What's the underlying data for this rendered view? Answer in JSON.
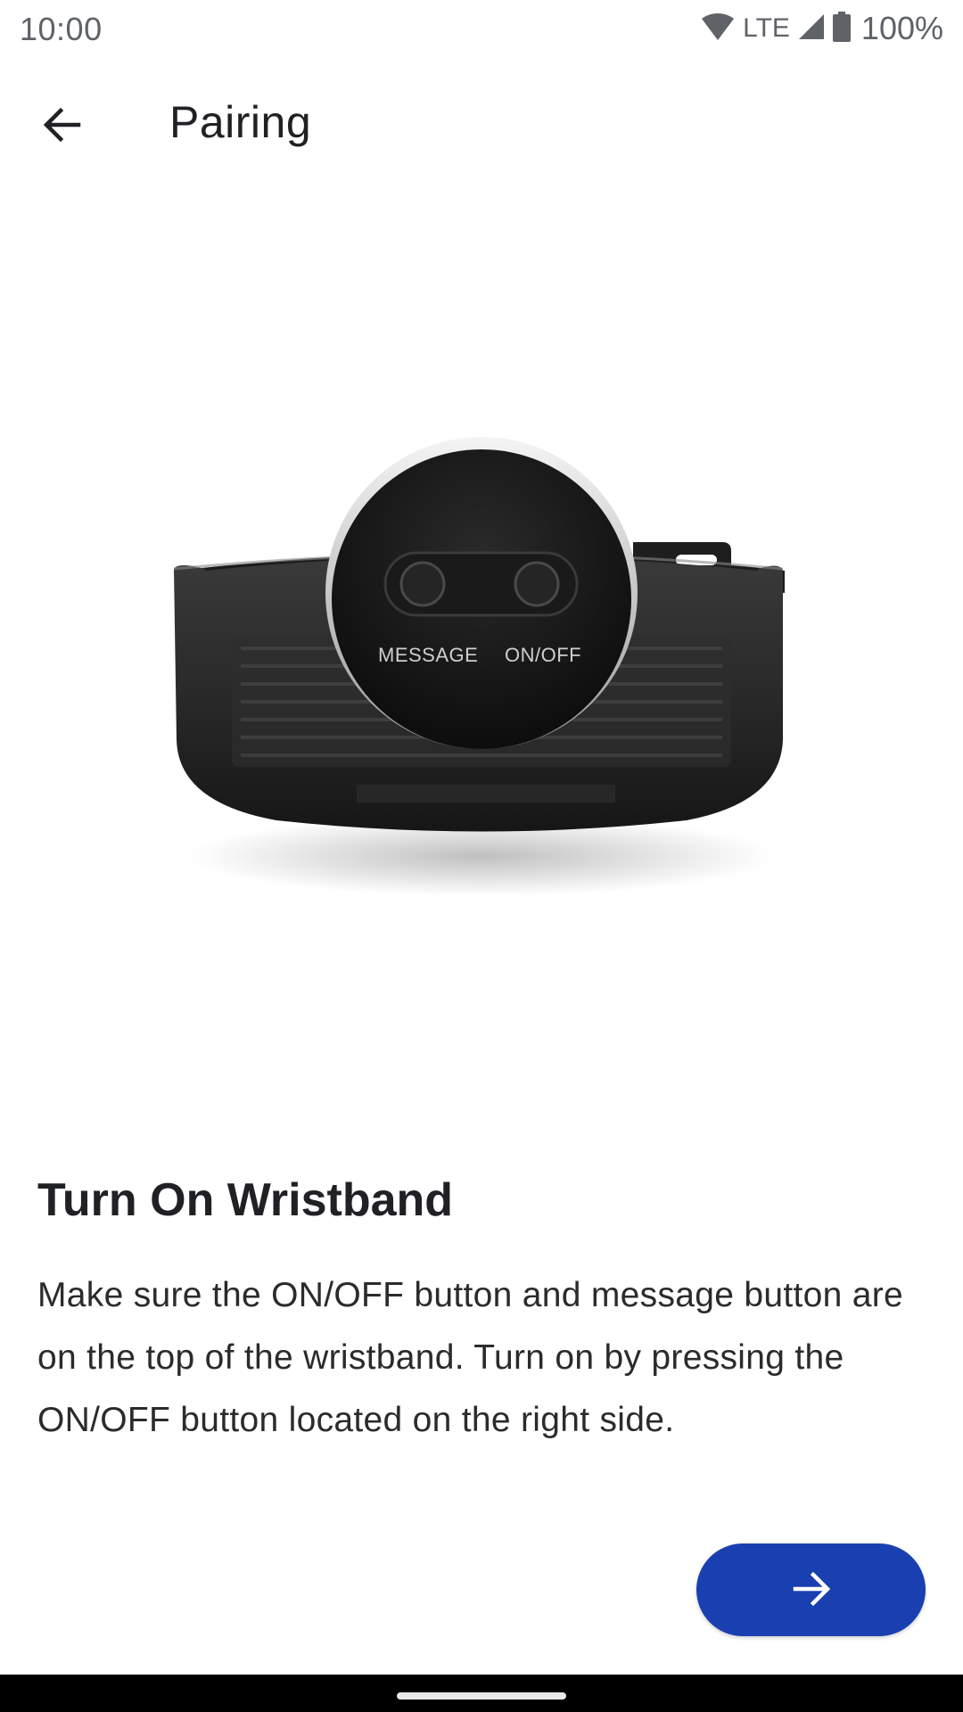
{
  "status_bar": {
    "time": "10:00",
    "network": "LTE",
    "battery": "100%",
    "icons": [
      "wifi-icon",
      "signal-icon",
      "battery-icon"
    ]
  },
  "app_bar": {
    "title": "Pairing",
    "back_icon": "arrow-left-icon"
  },
  "illustration": {
    "label_message": "MESSAGE",
    "label_onoff": "ON/OFF"
  },
  "content": {
    "heading": "Turn On Wristband",
    "body": "Make sure the ON/OFF button and message button are on the top of the wristband. Turn on by pressing the ON/OFF button located on the right side."
  },
  "next_button": {
    "icon": "arrow-right-icon",
    "color": "#1a3fb0"
  }
}
